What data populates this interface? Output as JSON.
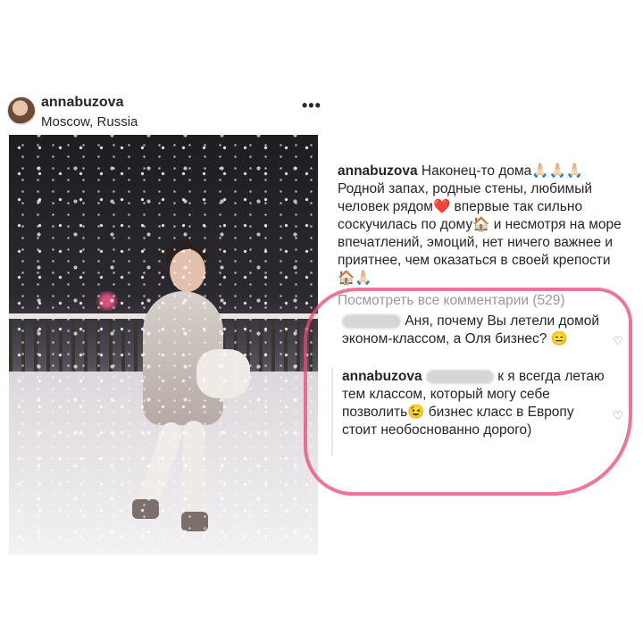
{
  "post": {
    "username": "annabuzova",
    "location": "Moscow, Russia",
    "more_icon": "•••"
  },
  "caption": {
    "handle": "annabuzova",
    "text": "Наконец-то дома🙏🏻🙏🏻🙏🏻 Родной запах, родные стены, любимый человек рядом❤️ впервые так сильно соскучилась по дому🏠 и несмотря на море впечатлений, эмоций, нет ничего важнее и приятнее, чем оказаться в своей крепости 🏠🙏🏻"
  },
  "comments": {
    "view_all": "Посмотреть все комментарии (529)",
    "items": [
      {
        "text": "Аня, почему Вы летели домой эконом-классом, а Оля бизнес? 😑"
      },
      {
        "handle": "annabuzova",
        "text": "к я всегда летаю тем классом, который могу себе позволить😉 бизнес класс в Европу стоит необоснованно дорого)"
      }
    ]
  },
  "icons": {
    "heart": "♡"
  },
  "colors": {
    "highlight": "#e94773",
    "muted_text": "#999999"
  }
}
